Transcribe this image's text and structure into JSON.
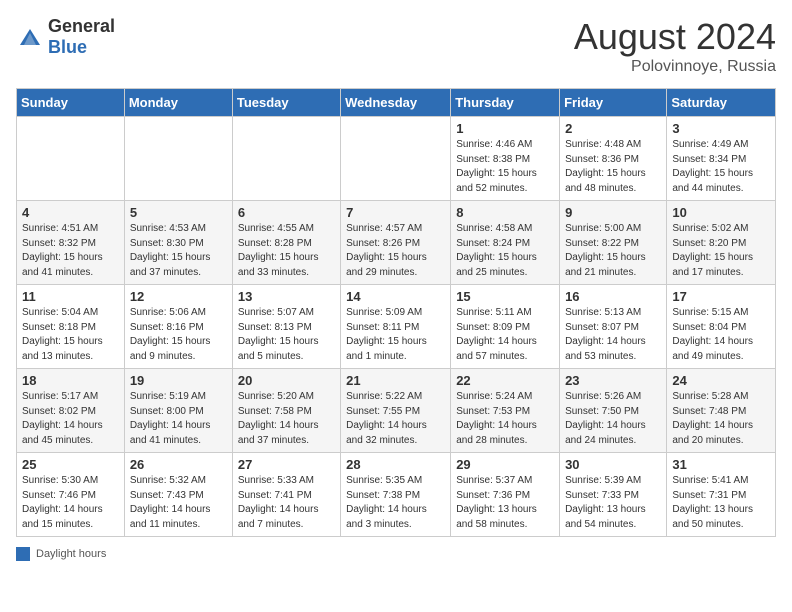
{
  "header": {
    "logo_general": "General",
    "logo_blue": "Blue",
    "month_year": "August 2024",
    "location": "Polovinnoye, Russia"
  },
  "footer": {
    "legend_label": "Daylight hours"
  },
  "weekdays": [
    "Sunday",
    "Monday",
    "Tuesday",
    "Wednesday",
    "Thursday",
    "Friday",
    "Saturday"
  ],
  "weeks": [
    [
      {
        "day": "",
        "info": ""
      },
      {
        "day": "",
        "info": ""
      },
      {
        "day": "",
        "info": ""
      },
      {
        "day": "",
        "info": ""
      },
      {
        "day": "1",
        "info": "Sunrise: 4:46 AM\nSunset: 8:38 PM\nDaylight: 15 hours\nand 52 minutes."
      },
      {
        "day": "2",
        "info": "Sunrise: 4:48 AM\nSunset: 8:36 PM\nDaylight: 15 hours\nand 48 minutes."
      },
      {
        "day": "3",
        "info": "Sunrise: 4:49 AM\nSunset: 8:34 PM\nDaylight: 15 hours\nand 44 minutes."
      }
    ],
    [
      {
        "day": "4",
        "info": "Sunrise: 4:51 AM\nSunset: 8:32 PM\nDaylight: 15 hours\nand 41 minutes."
      },
      {
        "day": "5",
        "info": "Sunrise: 4:53 AM\nSunset: 8:30 PM\nDaylight: 15 hours\nand 37 minutes."
      },
      {
        "day": "6",
        "info": "Sunrise: 4:55 AM\nSunset: 8:28 PM\nDaylight: 15 hours\nand 33 minutes."
      },
      {
        "day": "7",
        "info": "Sunrise: 4:57 AM\nSunset: 8:26 PM\nDaylight: 15 hours\nand 29 minutes."
      },
      {
        "day": "8",
        "info": "Sunrise: 4:58 AM\nSunset: 8:24 PM\nDaylight: 15 hours\nand 25 minutes."
      },
      {
        "day": "9",
        "info": "Sunrise: 5:00 AM\nSunset: 8:22 PM\nDaylight: 15 hours\nand 21 minutes."
      },
      {
        "day": "10",
        "info": "Sunrise: 5:02 AM\nSunset: 8:20 PM\nDaylight: 15 hours\nand 17 minutes."
      }
    ],
    [
      {
        "day": "11",
        "info": "Sunrise: 5:04 AM\nSunset: 8:18 PM\nDaylight: 15 hours\nand 13 minutes."
      },
      {
        "day": "12",
        "info": "Sunrise: 5:06 AM\nSunset: 8:16 PM\nDaylight: 15 hours\nand 9 minutes."
      },
      {
        "day": "13",
        "info": "Sunrise: 5:07 AM\nSunset: 8:13 PM\nDaylight: 15 hours\nand 5 minutes."
      },
      {
        "day": "14",
        "info": "Sunrise: 5:09 AM\nSunset: 8:11 PM\nDaylight: 15 hours\nand 1 minute."
      },
      {
        "day": "15",
        "info": "Sunrise: 5:11 AM\nSunset: 8:09 PM\nDaylight: 14 hours\nand 57 minutes."
      },
      {
        "day": "16",
        "info": "Sunrise: 5:13 AM\nSunset: 8:07 PM\nDaylight: 14 hours\nand 53 minutes."
      },
      {
        "day": "17",
        "info": "Sunrise: 5:15 AM\nSunset: 8:04 PM\nDaylight: 14 hours\nand 49 minutes."
      }
    ],
    [
      {
        "day": "18",
        "info": "Sunrise: 5:17 AM\nSunset: 8:02 PM\nDaylight: 14 hours\nand 45 minutes."
      },
      {
        "day": "19",
        "info": "Sunrise: 5:19 AM\nSunset: 8:00 PM\nDaylight: 14 hours\nand 41 minutes."
      },
      {
        "day": "20",
        "info": "Sunrise: 5:20 AM\nSunset: 7:58 PM\nDaylight: 14 hours\nand 37 minutes."
      },
      {
        "day": "21",
        "info": "Sunrise: 5:22 AM\nSunset: 7:55 PM\nDaylight: 14 hours\nand 32 minutes."
      },
      {
        "day": "22",
        "info": "Sunrise: 5:24 AM\nSunset: 7:53 PM\nDaylight: 14 hours\nand 28 minutes."
      },
      {
        "day": "23",
        "info": "Sunrise: 5:26 AM\nSunset: 7:50 PM\nDaylight: 14 hours\nand 24 minutes."
      },
      {
        "day": "24",
        "info": "Sunrise: 5:28 AM\nSunset: 7:48 PM\nDaylight: 14 hours\nand 20 minutes."
      }
    ],
    [
      {
        "day": "25",
        "info": "Sunrise: 5:30 AM\nSunset: 7:46 PM\nDaylight: 14 hours\nand 15 minutes."
      },
      {
        "day": "26",
        "info": "Sunrise: 5:32 AM\nSunset: 7:43 PM\nDaylight: 14 hours\nand 11 minutes."
      },
      {
        "day": "27",
        "info": "Sunrise: 5:33 AM\nSunset: 7:41 PM\nDaylight: 14 hours\nand 7 minutes."
      },
      {
        "day": "28",
        "info": "Sunrise: 5:35 AM\nSunset: 7:38 PM\nDaylight: 14 hours\nand 3 minutes."
      },
      {
        "day": "29",
        "info": "Sunrise: 5:37 AM\nSunset: 7:36 PM\nDaylight: 13 hours\nand 58 minutes."
      },
      {
        "day": "30",
        "info": "Sunrise: 5:39 AM\nSunset: 7:33 PM\nDaylight: 13 hours\nand 54 minutes."
      },
      {
        "day": "31",
        "info": "Sunrise: 5:41 AM\nSunset: 7:31 PM\nDaylight: 13 hours\nand 50 minutes."
      }
    ]
  ]
}
